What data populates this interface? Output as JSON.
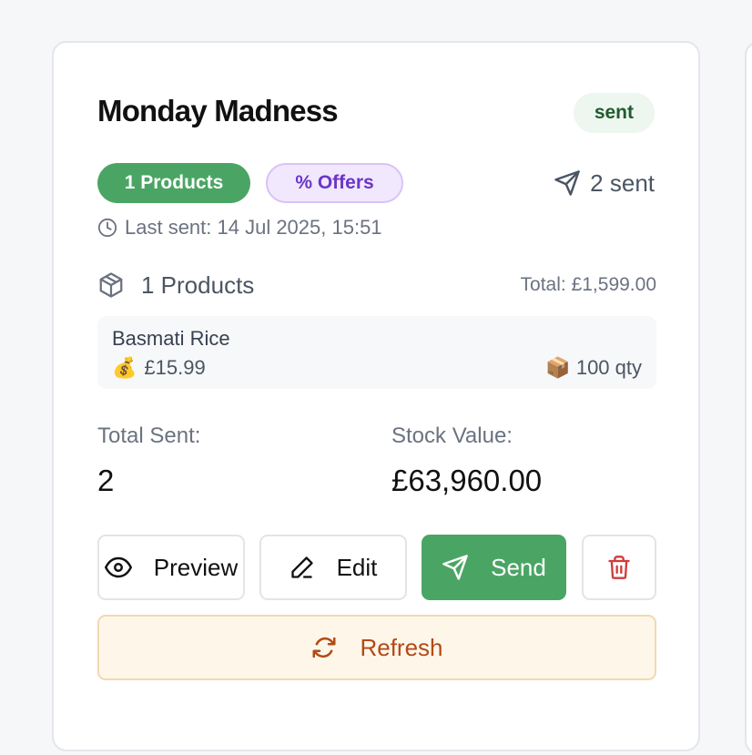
{
  "card": {
    "title": "Monday Madness",
    "status": "sent",
    "products_pill": "1 Products",
    "offers_pill": "% Offers",
    "sent_count": "2 sent",
    "last_sent": "Last sent: 14 Jul 2025, 15:51",
    "products_label": "1 Products",
    "total": "Total: £1,599.00",
    "product": {
      "name": "Basmati Rice",
      "price_emoji": "💰",
      "price": "£15.99",
      "qty_emoji": "📦",
      "qty": "100 qty"
    },
    "stats": {
      "total_sent_label": "Total Sent:",
      "total_sent_value": "2",
      "stock_value_label": "Stock Value:",
      "stock_value_value": "£63,960.00"
    },
    "actions": {
      "preview": "Preview",
      "edit": "Edit",
      "send": "Send",
      "refresh": "Refresh"
    }
  },
  "colors": {
    "primary_green": "#4aa564",
    "offer_purple": "#6b35c9",
    "delete_red": "#d23a3a",
    "refresh_orange": "#b14b16"
  },
  "icons": [
    "send-icon",
    "clock-icon",
    "box-icon",
    "eye-icon",
    "pencil-icon",
    "trash-icon",
    "refresh-icon"
  ]
}
